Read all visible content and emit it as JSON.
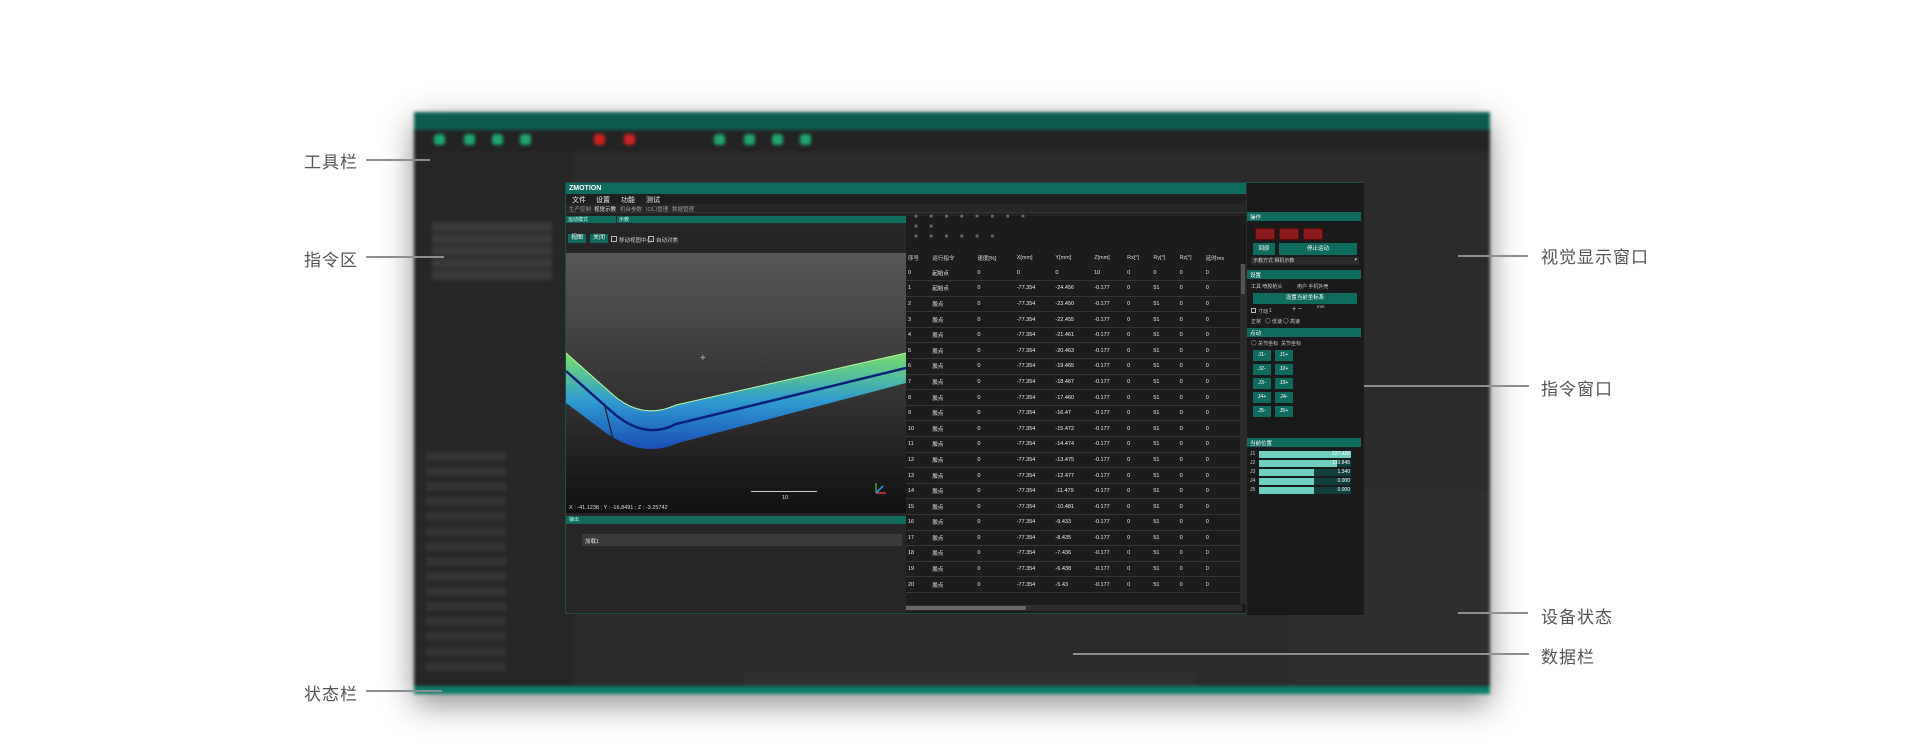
{
  "callouts": {
    "toolbar": "工具栏",
    "command_area": "指令区",
    "status_bar": "状态栏",
    "visual_window": "视觉显示窗口",
    "command_window": "指令窗口",
    "device_status": "设备状态",
    "data_bar": "数据栏"
  },
  "window": {
    "title": "ZMOTION",
    "menus": [
      "文件",
      "设置",
      "功能",
      "测试"
    ],
    "subtabs": [
      "生产控制",
      "视觉示教",
      "机台参数",
      "IO口管理",
      "数据管理"
    ]
  },
  "viewer": {
    "left_header": "运动模式",
    "right_header": "示教",
    "btn_view": "视图",
    "btn_close": "关闭",
    "check_center": "移动视图中心",
    "check_auto": "自动对焦",
    "coord_readout": "X : -41.1238 ; Y : -16.8491 ; Z : -3.25742",
    "scale_label": "10",
    "output_header": "输出",
    "output_text": "加载1"
  },
  "table": {
    "headers": [
      "序号",
      "运行指令",
      "速度[%]",
      "X[mm]",
      "Y[mm]",
      "Z[mm]",
      "Rx[°]",
      "Ry[°]",
      "Rz[°]",
      "延时ms"
    ],
    "rows": [
      [
        "0",
        "起始点",
        "0",
        "0",
        "0",
        "10",
        "0",
        "0",
        "0",
        "0"
      ],
      [
        "1",
        "起始点",
        "0",
        "-77.354",
        "-24.456",
        "-0.177",
        "0",
        "51",
        "0",
        "0"
      ],
      [
        "2",
        "胶点",
        "0",
        "-77.354",
        "-23.450",
        "-0.177",
        "0",
        "51",
        "0",
        "0"
      ],
      [
        "3",
        "胶点",
        "0",
        "-77.354",
        "-22.455",
        "-0.177",
        "0",
        "51",
        "0",
        "0"
      ],
      [
        "4",
        "胶点",
        "0",
        "-77.354",
        "-21.461",
        "-0.177",
        "0",
        "51",
        "0",
        "0"
      ],
      [
        "5",
        "胶点",
        "0",
        "-77.354",
        "-20.463",
        "-0.177",
        "0",
        "51",
        "0",
        "0"
      ],
      [
        "6",
        "胶点",
        "0",
        "-77.354",
        "-19.465",
        "-0.177",
        "0",
        "51",
        "0",
        "0"
      ],
      [
        "7",
        "胶点",
        "0",
        "-77.354",
        "-18.467",
        "-0.177",
        "0",
        "51",
        "0",
        "0"
      ],
      [
        "8",
        "胶点",
        "0",
        "-77.354",
        "-17.460",
        "-0.177",
        "0",
        "51",
        "0",
        "0"
      ],
      [
        "9",
        "胶点",
        "0",
        "-77.354",
        "-16.47",
        "-0.177",
        "0",
        "51",
        "0",
        "0"
      ],
      [
        "10",
        "胶点",
        "0",
        "-77.354",
        "-15.472",
        "-0.177",
        "0",
        "51",
        "0",
        "0"
      ],
      [
        "11",
        "胶点",
        "0",
        "-77.354",
        "-14.474",
        "-0.177",
        "0",
        "51",
        "0",
        "0"
      ],
      [
        "12",
        "胶点",
        "0",
        "-77.354",
        "-13.475",
        "-0.177",
        "0",
        "51",
        "0",
        "0"
      ],
      [
        "13",
        "胶点",
        "0",
        "-77.354",
        "-12.477",
        "-0.177",
        "0",
        "51",
        "0",
        "0"
      ],
      [
        "14",
        "胶点",
        "0",
        "-77.354",
        "-11.479",
        "-0.177",
        "0",
        "51",
        "0",
        "0"
      ],
      [
        "15",
        "胶点",
        "0",
        "-77.354",
        "-10.481",
        "-0.177",
        "0",
        "51",
        "0",
        "0"
      ],
      [
        "16",
        "胶点",
        "0",
        "-77.354",
        "-9.433",
        "-0.177",
        "0",
        "51",
        "0",
        "0"
      ],
      [
        "17",
        "胶点",
        "0",
        "-77.354",
        "-8.435",
        "-0.177",
        "0",
        "51",
        "0",
        "0"
      ],
      [
        "18",
        "胶点",
        "0",
        "-77.354",
        "-7.436",
        "-0.177",
        "0",
        "51",
        "0",
        "0"
      ],
      [
        "19",
        "胶点",
        "0",
        "-77.354",
        "-6.438",
        "-0.177",
        "0",
        "51",
        "0",
        "0"
      ],
      [
        "20",
        "胶点",
        "0",
        "-77.354",
        "-5.43",
        "-0.177",
        "0",
        "51",
        "0",
        "0"
      ]
    ]
  },
  "panel": {
    "ops_header": "操作",
    "btn_reset": "回原",
    "btn_stop": "停止运动",
    "select_mode": "示教方式  相机示教",
    "settings_header": "设置",
    "tool_label": "工具  喷胶枪头",
    "user_label": "用户  手机外壳",
    "btn_setpos": "设置当前坐标系",
    "step_label": "寸动",
    "step_value": "1",
    "step_unit": "mm",
    "speed_label": "正常",
    "speed_low": "低速",
    "speed_high": "高速",
    "jog_header": "点动",
    "coord_joint": "关节坐标",
    "coord_space": "关节坐标",
    "jog_buttons": [
      [
        "J1-",
        "J1+"
      ],
      [
        "J2-",
        "J2+"
      ],
      [
        "J3-",
        "J3+"
      ],
      [
        "J4+",
        "J4-"
      ],
      [
        "J5-",
        "J5+"
      ]
    ],
    "pos_header": "当前位置",
    "positions": [
      {
        "label": "J1",
        "value": "227.426",
        "fill": 1.0
      },
      {
        "label": "J2",
        "value": "110.845",
        "fill": 0.85
      },
      {
        "label": "J3",
        "value": "1.340",
        "fill": 0.6
      },
      {
        "label": "J4",
        "value": "0.000",
        "fill": 0.6
      },
      {
        "label": "J5",
        "value": "0.000",
        "fill": 0.6
      }
    ]
  }
}
